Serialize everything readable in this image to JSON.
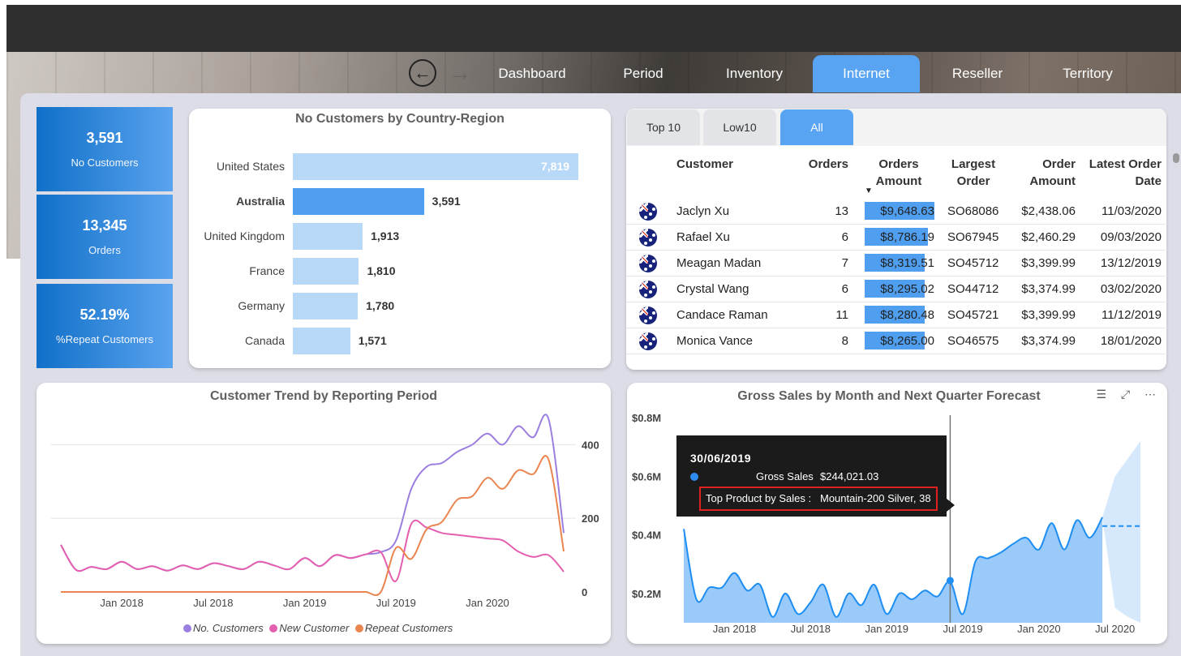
{
  "nav": {
    "back_icon": "arrow-left-circle-icon",
    "forward_icon": "arrow-right-icon",
    "tabs": [
      {
        "label": "Dashboard"
      },
      {
        "label": "Period"
      },
      {
        "label": "Inventory"
      },
      {
        "label": "Internet",
        "active": true
      },
      {
        "label": "Reseller"
      },
      {
        "label": "Territory"
      }
    ],
    "active_color": "#59a4f2"
  },
  "kpis": [
    {
      "value": "3,591",
      "label": "No Customers"
    },
    {
      "value": "13,345",
      "label": "Orders"
    },
    {
      "value": "52.19%",
      "label": "%Repeat Customers"
    }
  ],
  "country_chart": {
    "title": "No Customers by Country-Region",
    "chart_data": {
      "type": "bar",
      "orientation": "horizontal",
      "categories": [
        "United States",
        "Australia",
        "United Kingdom",
        "France",
        "Germany",
        "Canada"
      ],
      "values": [
        7819,
        3591,
        1913,
        1810,
        1780,
        1571
      ],
      "value_labels": [
        "7,819",
        "3,591",
        "1,913",
        "1,810",
        "1,780",
        "1,571"
      ],
      "highlighted": "Australia",
      "colors": {
        "bar": "#b8d8f7",
        "highlight": "#4f9ef0"
      }
    }
  },
  "customer_table": {
    "filter_tabs": [
      {
        "label": "Top 10"
      },
      {
        "label": "Low10"
      },
      {
        "label": "All",
        "active": true
      }
    ],
    "columns": [
      "Customer",
      "Orders",
      "Orders Amount",
      "Largest Order",
      "Order Amount",
      "Latest Order Date"
    ],
    "sort_indicator": "▼",
    "rows": [
      {
        "customer": "Jaclyn Xu",
        "orders": "13",
        "orders_amount": "$9,648.63",
        "amount_value": 9648.63,
        "largest_order": "SO68086",
        "order_amount": "$2,438.06",
        "latest_date": "11/03/2020"
      },
      {
        "customer": "Rafael Xu",
        "orders": "6",
        "orders_amount": "$8,786.19",
        "amount_value": 8786.19,
        "largest_order": "SO67945",
        "order_amount": "$2,460.29",
        "latest_date": "09/03/2020"
      },
      {
        "customer": "Meagan Madan",
        "orders": "7",
        "orders_amount": "$8,319.51",
        "amount_value": 8319.51,
        "largest_order": "SO45712",
        "order_amount": "$3,399.99",
        "latest_date": "13/12/2019"
      },
      {
        "customer": "Crystal Wang",
        "orders": "6",
        "orders_amount": "$8,295.02",
        "amount_value": 8295.02,
        "largest_order": "SO44712",
        "order_amount": "$3,374.99",
        "latest_date": "03/02/2020"
      },
      {
        "customer": "Candace Raman",
        "orders": "11",
        "orders_amount": "$8,280.48",
        "amount_value": 8280.48,
        "largest_order": "SO45721",
        "order_amount": "$3,399.99",
        "latest_date": "11/12/2019"
      },
      {
        "customer": "Monica Vance",
        "orders": "8",
        "orders_amount": "$8,265.00",
        "amount_value": 8265.0,
        "largest_order": "SO46575",
        "order_amount": "$3,374.99",
        "latest_date": "18/01/2020"
      }
    ]
  },
  "trend_chart": {
    "title": "Customer Trend by Reporting Period",
    "chart_data": {
      "type": "line",
      "x_ticks": [
        "Jan 2018",
        "Jul 2018",
        "Jan 2019",
        "Jul 2019",
        "Jan 2020"
      ],
      "y_ticks": [
        "0",
        "200",
        "400"
      ],
      "ylim": [
        0,
        480
      ],
      "grid": true,
      "x": [
        "2017-09",
        "2017-10",
        "2017-11",
        "2017-12",
        "2018-01",
        "2018-02",
        "2018-03",
        "2018-04",
        "2018-05",
        "2018-06",
        "2018-07",
        "2018-08",
        "2018-09",
        "2018-10",
        "2018-11",
        "2018-12",
        "2019-01",
        "2019-02",
        "2019-03",
        "2019-04",
        "2019-05",
        "2019-06",
        "2019-07",
        "2019-08",
        "2019-09",
        "2019-10",
        "2019-11",
        "2019-12",
        "2020-01",
        "2020-02",
        "2020-03",
        "2020-04",
        "2020-05",
        "2020-06"
      ],
      "series": [
        {
          "name": "No. Customers",
          "color": "#9b7ee0",
          "values": [
            128,
            60,
            68,
            62,
            82,
            62,
            70,
            58,
            72,
            62,
            78,
            70,
            62,
            82,
            72,
            62,
            92,
            70,
            100,
            92,
            102,
            108,
            140,
            280,
            340,
            350,
            380,
            400,
            430,
            400,
            450,
            420,
            470,
            160
          ]
        },
        {
          "name": "New Customer",
          "color": "#e55fb0",
          "values": [
            128,
            60,
            68,
            62,
            82,
            62,
            70,
            58,
            72,
            62,
            78,
            70,
            62,
            82,
            72,
            62,
            92,
            70,
            100,
            92,
            102,
            108,
            30,
            185,
            175,
            160,
            155,
            150,
            145,
            140,
            110,
            95,
            100,
            55
          ]
        },
        {
          "name": "Repeat Customers",
          "color": "#ea8550",
          "values": [
            0,
            0,
            0,
            0,
            0,
            0,
            0,
            0,
            0,
            0,
            0,
            0,
            0,
            0,
            0,
            0,
            0,
            0,
            0,
            0,
            0,
            0,
            120,
            90,
            170,
            190,
            250,
            260,
            310,
            280,
            330,
            320,
            360,
            110
          ]
        }
      ],
      "legend": "bottom-center"
    }
  },
  "sales_chart": {
    "title": "Gross Sales by Month and Next Quarter Forecast",
    "header_icons": [
      "filter-icon",
      "focus-mode-icon",
      "more-options-icon"
    ],
    "chart_data": {
      "type": "area",
      "x_ticks": [
        "Jan 2018",
        "Jul 2018",
        "Jan 2019",
        "Jul 2019",
        "Jan 2020",
        "Jul 2020"
      ],
      "y_ticks": [
        "$0.2M",
        "$0.4M",
        "$0.6M",
        "$0.8M"
      ],
      "ylim": [
        0.1,
        0.8
      ],
      "x": [
        "2017-09",
        "2017-10",
        "2017-11",
        "2017-12",
        "2018-01",
        "2018-02",
        "2018-03",
        "2018-04",
        "2018-05",
        "2018-06",
        "2018-07",
        "2018-08",
        "2018-09",
        "2018-10",
        "2018-11",
        "2018-12",
        "2019-01",
        "2019-02",
        "2019-03",
        "2019-04",
        "2019-05",
        "2019-06",
        "2019-07",
        "2019-08",
        "2019-09",
        "2019-10",
        "2019-11",
        "2019-12",
        "2020-01",
        "2020-02",
        "2020-03",
        "2020-04",
        "2020-05",
        "2020-06"
      ],
      "values": [
        0.42,
        0.18,
        0.22,
        0.22,
        0.27,
        0.21,
        0.23,
        0.12,
        0.2,
        0.13,
        0.17,
        0.23,
        0.12,
        0.2,
        0.16,
        0.23,
        0.13,
        0.2,
        0.18,
        0.21,
        0.19,
        0.24,
        0.13,
        0.31,
        0.32,
        0.34,
        0.37,
        0.39,
        0.35,
        0.44,
        0.35,
        0.45,
        0.39,
        0.46
      ],
      "forecast": {
        "x": [
          "2020-07",
          "2020-08",
          "2020-09"
        ],
        "value": 0.43,
        "lower": [
          0.15,
          0.12,
          0.1
        ],
        "upper": [
          0.6,
          0.66,
          0.72
        ]
      },
      "colors": {
        "line": "#1e8ef2",
        "area": "#8ec4f8",
        "forecast_band": "#cfe4fb"
      },
      "highlight": {
        "x": "2019-06",
        "value": 0.244
      }
    },
    "tooltip": {
      "date": "30/06/2019",
      "gross_sales_label": "Gross Sales",
      "gross_sales_value": "$244,021.03",
      "top_product_label": "Top Product by Sales :",
      "top_product_value": "Mountain-200 Silver, 38"
    }
  }
}
